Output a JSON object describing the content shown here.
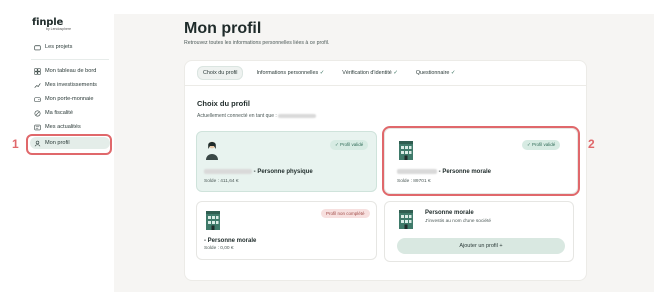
{
  "brand": {
    "logo": "finple",
    "logo_sub": "by Lendosphere"
  },
  "sidebar": {
    "items": [
      {
        "label": "Les projets",
        "icon": "folder-icon"
      },
      {
        "label": "Mon tableau de bord",
        "icon": "dashboard-icon"
      },
      {
        "label": "Mes investissements",
        "icon": "chart-icon"
      },
      {
        "label": "Mon porte-monnaie",
        "icon": "wallet-icon"
      },
      {
        "label": "Ma fiscalité",
        "icon": "tax-icon"
      },
      {
        "label": "Mes actualités",
        "icon": "news-icon"
      },
      {
        "label": "Mon profil",
        "icon": "user-icon"
      }
    ],
    "active": "Mon profil"
  },
  "annotations": {
    "left_number": "1",
    "right_number": "2"
  },
  "page": {
    "title": "Mon profil",
    "subtitle": "Retrouvez toutes les informations personnelles liées à ce profil."
  },
  "tabs": [
    {
      "label": "Choix du profil",
      "check": ""
    },
    {
      "label": "Informations personnelles",
      "check": "✓"
    },
    {
      "label": "Vérification d'identité",
      "check": "✓"
    },
    {
      "label": "Questionnaire",
      "check": "✓"
    }
  ],
  "section": {
    "title": "Choix du profil",
    "connected_label": "Actuellement connecté en tant que :"
  },
  "cards": [
    {
      "name": "- Personne physique",
      "balance": "Solde : 411,64 €",
      "badge": "✓ Profil validé",
      "badge_type": "ok",
      "icon": "person-avatar-icon"
    },
    {
      "name": "- Personne morale",
      "balance": "Solde : 89701 €",
      "badge": "✓ Profil validé",
      "badge_type": "ok",
      "icon": "building-icon"
    },
    {
      "name": "- Personne morale",
      "balance": "Solde : 0,00 €",
      "badge": "Profil non complété",
      "badge_type": "warn",
      "icon": "building-icon"
    },
    {
      "name": "Personne morale",
      "balance": "J'investis au nom d'une société",
      "badge": "",
      "icon": "building-icon"
    }
  ],
  "add_profile_button": "Ajouter un profil +",
  "colors": {
    "accent": "#e0686b",
    "validated_bg": "#e8f3ef",
    "button_bg": "#d9e8e1"
  }
}
